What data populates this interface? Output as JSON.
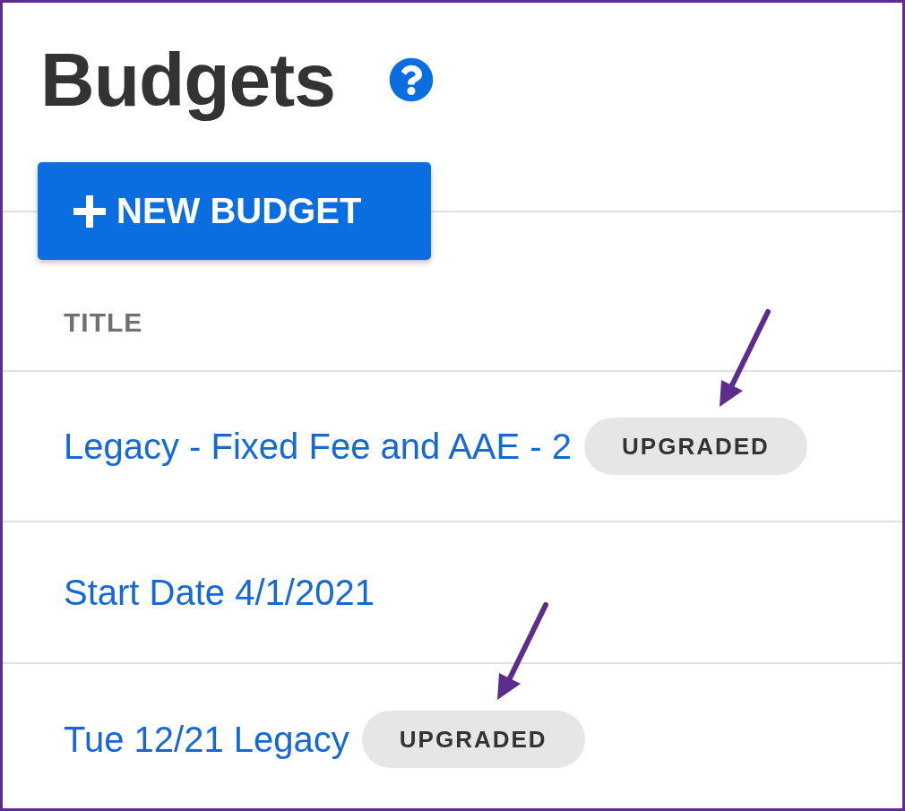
{
  "page": {
    "title": "Budgets"
  },
  "new_budget_button": {
    "label": "NEW BUDGET"
  },
  "table": {
    "columns": [
      "TITLE"
    ],
    "rows": [
      {
        "title": "Legacy - Fixed Fee and AAE - 2",
        "badge": "UPGRADED",
        "annotated": true
      },
      {
        "title": "Start Date 4/1/2021",
        "annotated": false
      },
      {
        "title": "Tue 12/21 Legacy",
        "badge": "UPGRADED",
        "annotated": true
      }
    ]
  }
}
